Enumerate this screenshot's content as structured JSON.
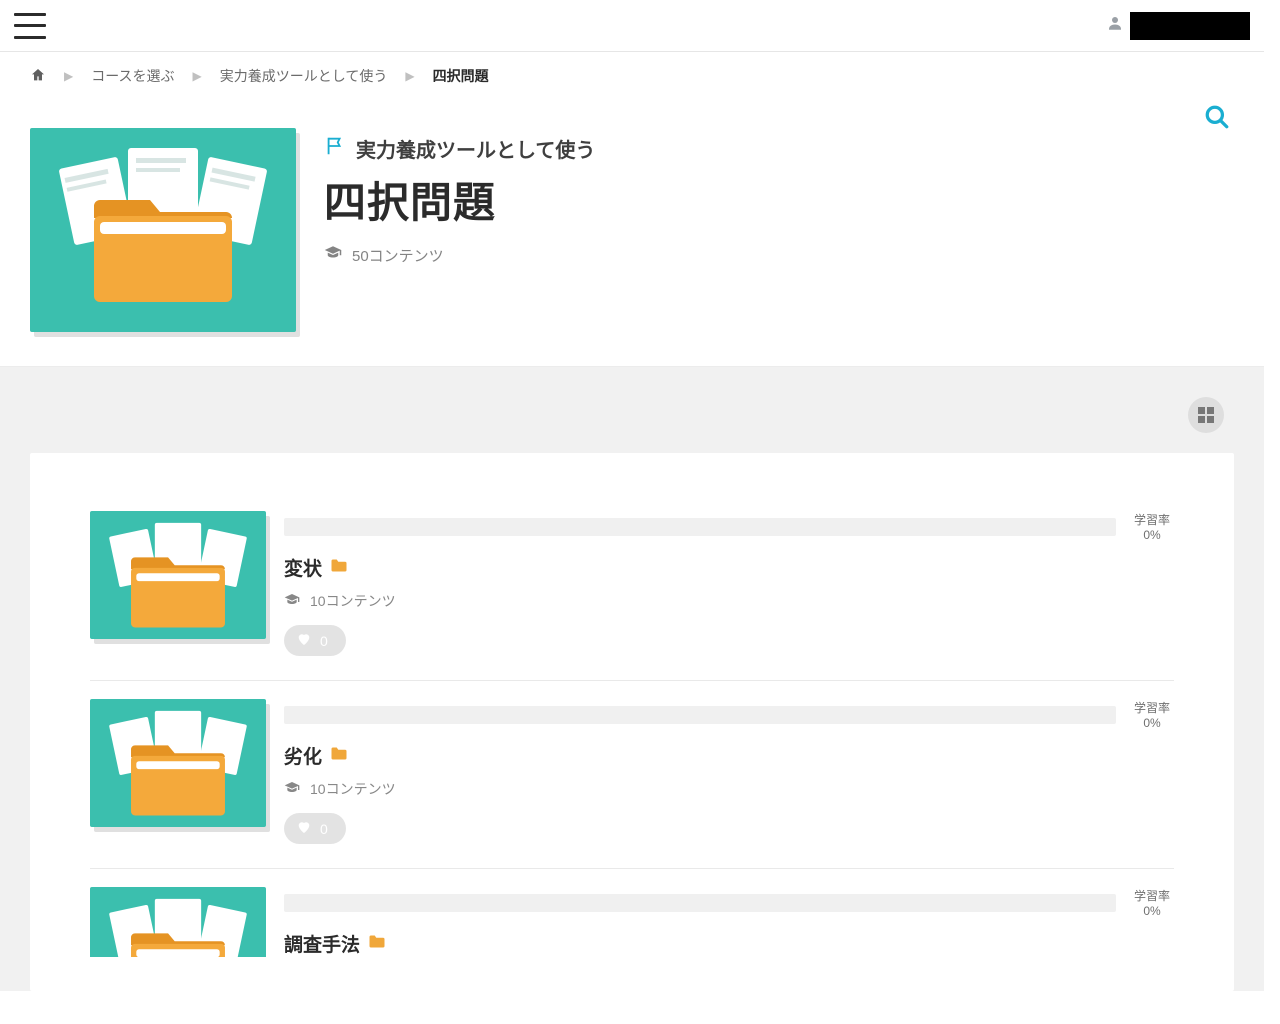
{
  "breadcrumbs": {
    "items": [
      {
        "label": "コースを選ぶ"
      },
      {
        "label": "実力養成ツールとして使う"
      },
      {
        "label": "四択問題",
        "current": true
      }
    ]
  },
  "hero": {
    "parent_label": "実力養成ツールとして使う",
    "title": "四択問題",
    "content_count": "50コンテンツ"
  },
  "labels": {
    "learning_rate": "学習率"
  },
  "items": [
    {
      "title": "変状",
      "count": "10コンテンツ",
      "likes": "0",
      "progress_pct": "0%"
    },
    {
      "title": "劣化",
      "count": "10コンテンツ",
      "likes": "0",
      "progress_pct": "0%"
    },
    {
      "title": "調査手法",
      "count": "",
      "likes": "",
      "progress_pct": "0%"
    }
  ]
}
